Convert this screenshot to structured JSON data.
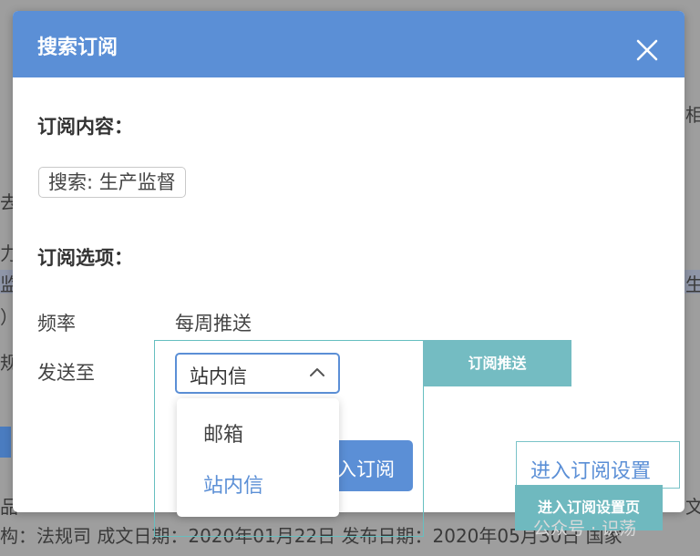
{
  "background": {
    "right_text_1": "相",
    "left_text_1": "去",
    "left_text_2": "力",
    "left_text_3": "监",
    "right_text_2": "生",
    "left_text_4": "）",
    "left_text_5": "规",
    "bottom_line_1": "品",
    "bottom_line_1_right": "文",
    "bottom_line_2": "构：法规司 成文日期：2020年01月22日 发布日期：2020年05月30日 国家"
  },
  "modal": {
    "title": "搜索订阅",
    "content_title": "订阅内容：",
    "search_tag": "搜索: 生产监督",
    "options_title": "订阅选项：",
    "frequency_label": "频率",
    "frequency_value": "每周推送",
    "send_to_label": "发送至",
    "send_to_selected": "站内信",
    "dropdown_options": [
      "邮箱",
      "站内信"
    ],
    "subscribe_button": "入订阅"
  },
  "annotations": {
    "push_label": "订阅推送",
    "settings_link": "进入订阅设置",
    "settings_page_label": "进入订阅设置页",
    "watermark": "公众号 · 识荡"
  },
  "colors": {
    "accent": "#5b8fd6",
    "annotation_teal": "#74bcc2",
    "overlay_bg": "#9e9e9e"
  }
}
